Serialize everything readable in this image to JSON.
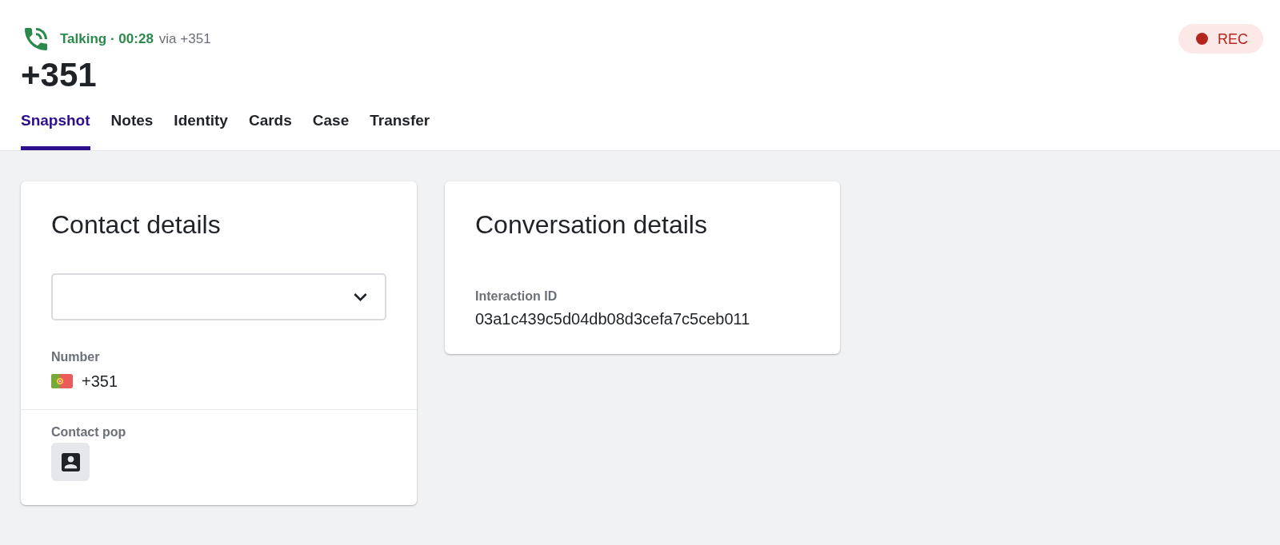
{
  "call": {
    "status": "Talking · 00:28",
    "via": "via +351",
    "title": "+351",
    "recording": {
      "label": "REC"
    }
  },
  "tabs": [
    {
      "label": "Snapshot",
      "selected": true
    },
    {
      "label": "Notes",
      "selected": false
    },
    {
      "label": "Identity",
      "selected": false
    },
    {
      "label": "Cards",
      "selected": false
    },
    {
      "label": "Case",
      "selected": false
    },
    {
      "label": "Transfer",
      "selected": false
    }
  ],
  "cards": [
    {
      "title": "Contact details",
      "sections": [
        {
          "kind": "select"
        },
        {
          "kind": "phone",
          "label": "Number",
          "value": "+351"
        },
        {
          "kind": "action",
          "label": "Contact pop"
        }
      ]
    },
    {
      "title": "Conversation details",
      "sections": [
        {
          "kind": "text",
          "label": "Interaction ID",
          "value": "03a1c439c5d04db08d3cefa7c5ceb011"
        }
      ]
    }
  ]
}
